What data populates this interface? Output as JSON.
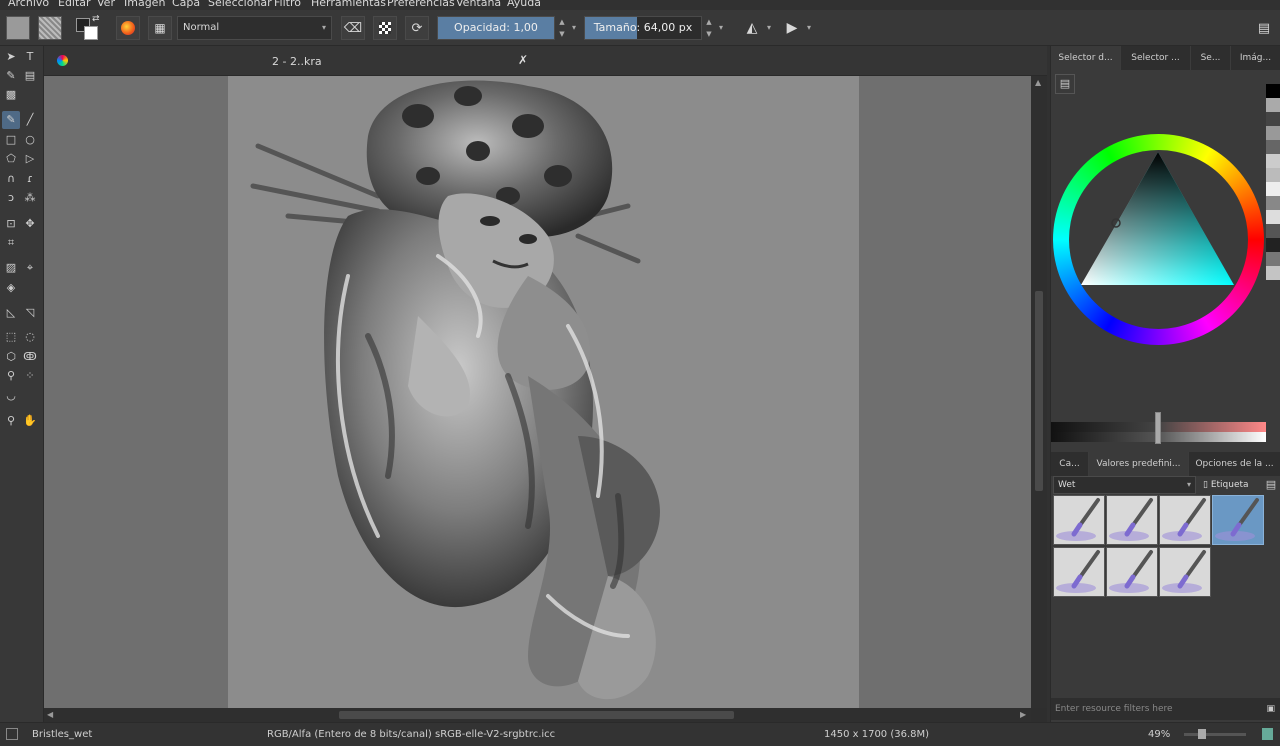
{
  "menu": [
    "Archivo",
    "Editar",
    "Ver",
    "Imagen",
    "Capa",
    "Seleccionar",
    "Filtro",
    "Herramientas",
    "Preferencias",
    "Ventana",
    "Ayuda"
  ],
  "toolbar": {
    "blend_mode": "Normal",
    "opacity_label": "Opacidad:  1,00",
    "opacity_value": 1.0,
    "size_label": "Tamaño:  64,00 px",
    "size_fraction": 0.45
  },
  "document": {
    "tab_title": "2 - 2..kra"
  },
  "dock_top_tabs": [
    "Selector d...",
    "Selector ...",
    "Se...",
    "Imág..."
  ],
  "dock_bottom_tabs": [
    "Ca...",
    "Valores predefini...",
    "Opciones de la ..."
  ],
  "presets": {
    "tag_filter": "Wet",
    "tag_button": "Etiqueta",
    "filter_placeholder": "Enter resource filters here",
    "brushes": [
      "wet-brush-1",
      "wet-brush-2",
      "wet-brush-3",
      "wet-brush-4",
      "wet-brush-5",
      "wet-brush-6",
      "wet-brush-7"
    ],
    "selected_index": 3
  },
  "status": {
    "brush_name": "Bristles_wet",
    "color_info": "RGB/Alfa (Entero de 8 bits/canal)  sRGB-elle-V2-srgbtrc.icc",
    "image_size": "1450 x 1700 (36.8M)",
    "zoom": "49%"
  },
  "colors": {
    "accent": "#5a7ea3",
    "panel": "#3a3a3a",
    "canvas_bg": "#6f6f6f",
    "paper": "#8c8c8c"
  }
}
